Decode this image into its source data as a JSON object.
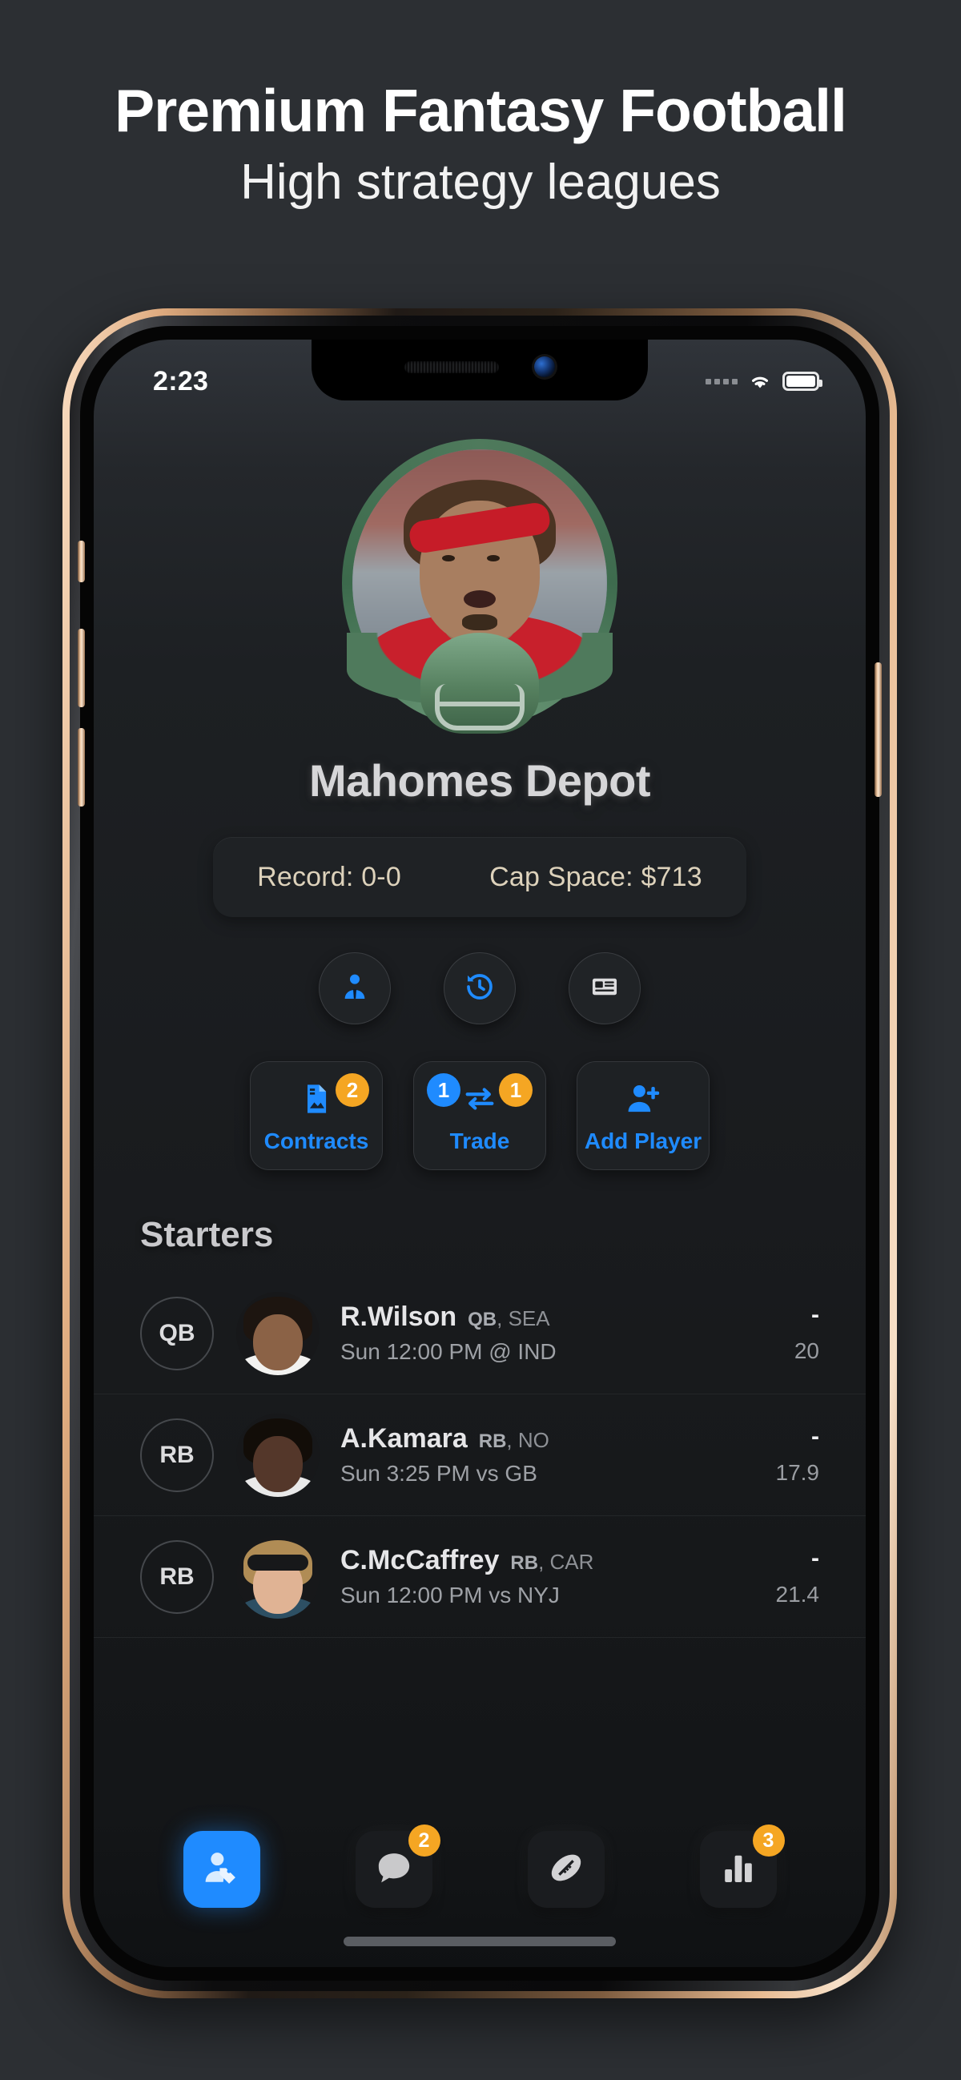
{
  "promo": {
    "title": "Premium Fantasy Football",
    "subtitle": "High strategy leagues"
  },
  "status_bar": {
    "time": "2:23",
    "signal_icon": "signal-dots-icon",
    "wifi_icon": "wifi-icon",
    "battery_icon": "battery-icon"
  },
  "team": {
    "avatar_alt": "player-avatar",
    "name": "Mahomes Depot",
    "record_label": "Record: 0-0",
    "cap_space_label": "Cap Space: $713"
  },
  "quick_actions": [
    {
      "name": "manager-button",
      "icon": "manager-icon"
    },
    {
      "name": "history-button",
      "icon": "history-icon"
    },
    {
      "name": "news-button",
      "icon": "news-icon"
    }
  ],
  "action_cards": [
    {
      "name": "contracts-card",
      "label": "Contracts",
      "icon": "contract-document-icon",
      "badges": [
        {
          "value": "2",
          "color": "#f5a623",
          "position": "top-right"
        }
      ]
    },
    {
      "name": "trade-card",
      "label": "Trade",
      "icon": "trade-arrows-icon",
      "badges": [
        {
          "value": "1",
          "color": "#1f8bff",
          "position": "top-left"
        },
        {
          "value": "1",
          "color": "#f5a623",
          "position": "top-right"
        }
      ]
    },
    {
      "name": "add-player-card",
      "label": "Add Player",
      "icon": "add-person-icon",
      "badges": []
    }
  ],
  "roster": {
    "section_title": "Starters",
    "players": [
      {
        "position": "QB",
        "name": "R.Wilson",
        "pos_team": "QB, SEA",
        "pos_short": "QB",
        "team_short": ", SEA",
        "game": "Sun 12:00 PM @ IND",
        "actual": "-",
        "projected": "20"
      },
      {
        "position": "RB",
        "name": "A.Kamara",
        "pos_team": "RB, NO",
        "pos_short": "RB",
        "team_short": ", NO",
        "game": "Sun 3:25 PM vs GB",
        "actual": "-",
        "projected": "17.9"
      },
      {
        "position": "RB",
        "name": "C.McCaffrey",
        "pos_team": "RB, CAR",
        "pos_short": "RB",
        "team_short": ", CAR",
        "game": "Sun 12:00 PM vs NYJ",
        "actual": "-",
        "projected": "21.4"
      }
    ]
  },
  "tab_bar": [
    {
      "name": "tab-team",
      "icon": "player-tag-icon",
      "active": true,
      "badge": ""
    },
    {
      "name": "tab-messages",
      "icon": "chat-bubble-icon",
      "active": false,
      "badge": "2"
    },
    {
      "name": "tab-league",
      "icon": "football-icon",
      "active": false,
      "badge": ""
    },
    {
      "name": "tab-stats",
      "icon": "bar-chart-icon",
      "active": false,
      "badge": "3"
    }
  ],
  "colors": {
    "accent_blue": "#1f8bff",
    "badge_orange": "#f5a623",
    "screen_bg": "#1a1c1f",
    "pill_text": "#ddd2bb"
  }
}
